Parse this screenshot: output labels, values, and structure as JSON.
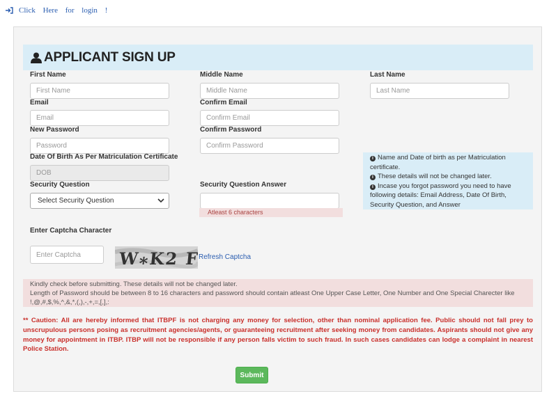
{
  "login_link": "Click Here for login !",
  "header": {
    "title": "APPLICANT SIGN UP"
  },
  "fields": {
    "first_name": {
      "label": "First Name",
      "placeholder": "First Name"
    },
    "middle_name": {
      "label": "Middle Name",
      "placeholder": "Middle Name"
    },
    "last_name": {
      "label": "Last Name",
      "placeholder": "Last Name"
    },
    "email": {
      "label": "Email",
      "placeholder": "Email"
    },
    "confirm_email": {
      "label": "Confirm Email",
      "placeholder": "Confirm Email"
    },
    "new_password": {
      "label": "New Password",
      "placeholder": "Password"
    },
    "confirm_password": {
      "label": "Confirm Password",
      "placeholder": "Confirm Password"
    },
    "dob": {
      "label": "Date Of Birth As Per Matriculation Certificate",
      "placeholder": "DOB"
    },
    "security_question": {
      "label": "Security Question",
      "value": "Select Security Question"
    },
    "security_answer": {
      "label": "Security Question Answer",
      "hint": "Atleast 6 characters"
    },
    "captcha": {
      "label": "Enter Captcha Character",
      "placeholder": "Enter Captcha",
      "image_text": "W⁎K2 F",
      "refresh": "Refresh Captcha"
    }
  },
  "info": {
    "line1": "Name and Date of birth as per Matriculation certificate.",
    "line2": "These details will not be changed later.",
    "line3": "Incase you forgot password you need to have following details: Email Address, Date Of Birth, Security Question, and Answer"
  },
  "warning": {
    "line1": "Kindly check before submitting. These details will not be changed later.",
    "line2": "Length of Password should be between 8 to 16 characters and password should contain atleast One Upper Case Letter, One Number and One Special Charecter like !,@,#,$,%,^,&,*,(,),-,+,=,[,],:"
  },
  "caution": "** Caution: All are hereby informed that ITBPF is not charging any money for selection, other than nominal application fee. Public should not fall prey to unscrupulous persons posing as recruitment agencies/agents, or guaranteeing recruitment after seeking money from candidates. Aspirants should not give any money for appointment in ITBP. ITBP will not be responsible if any person falls victim to such fraud. In such cases candidates can lodge a complaint in nearest Police Station.",
  "submit_label": "Submit",
  "colors": {
    "header_bg": "#d9edf7",
    "submit_bg": "#5cb85c",
    "caution_text": "#c9302c",
    "warning_bg": "#f2dede",
    "link": "#2a5db0"
  }
}
